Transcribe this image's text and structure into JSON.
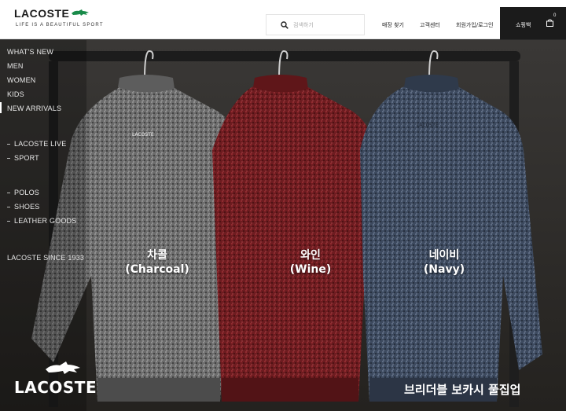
{
  "header": {
    "logo_text": "LACOSTE",
    "tagline": "LIFE IS A BEAUTIFUL SPORT",
    "search_placeholder": "검색하기",
    "links": [
      "매장 찾기",
      "고객센터",
      "회원가입/로그인"
    ],
    "cart_label": "쇼핑백",
    "cart_count": "0"
  },
  "sidenav": {
    "primary": [
      "WHAT'S NEW",
      "MEN",
      "WOMEN",
      "KIDS",
      "NEW ARRIVALS"
    ],
    "group1": [
      "LACOSTE LIVE",
      "SPORT"
    ],
    "group2": [
      "POLOS",
      "SHOES",
      "LEATHER GOODS"
    ],
    "footer_item": "LACOSTE SINCE 1933"
  },
  "products": [
    {
      "ko": "차콜",
      "en": "(Charcoal)"
    },
    {
      "ko": "와인",
      "en": "(Wine)"
    },
    {
      "ko": "네이비",
      "en": "(Navy)"
    }
  ],
  "brand_bottom": "LACOSTE",
  "product_title": "브리더블 보카시 풀집업",
  "colors": {
    "charcoal": "#6b6b6b",
    "wine": "#7a1e22",
    "navy": "#3e4a5e",
    "lacoste_green": "#1a8b4a"
  }
}
